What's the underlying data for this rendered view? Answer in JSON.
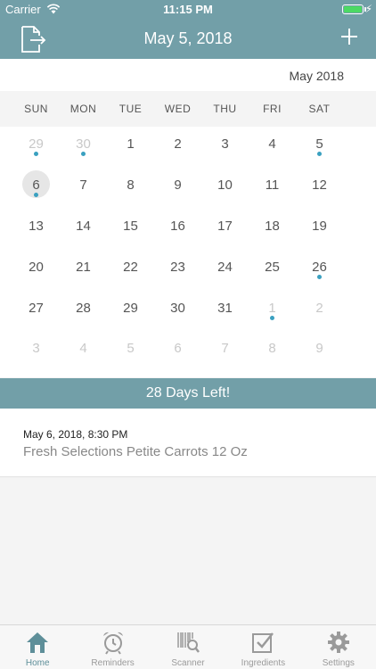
{
  "status_bar": {
    "carrier": "Carrier",
    "time": "11:15 PM",
    "bolt": "⚡"
  },
  "nav": {
    "title": "May 5, 2018"
  },
  "calendar": {
    "month_label": "May 2018",
    "weekdays": [
      "SUN",
      "MON",
      "TUE",
      "WED",
      "THU",
      "FRI",
      "SAT"
    ],
    "weeks": [
      [
        {
          "d": "29",
          "other": true,
          "dot": true
        },
        {
          "d": "30",
          "other": true,
          "dot": true
        },
        {
          "d": "1"
        },
        {
          "d": "2"
        },
        {
          "d": "3"
        },
        {
          "d": "4"
        },
        {
          "d": "5",
          "dot": true
        }
      ],
      [
        {
          "d": "6",
          "today": true,
          "dot": true
        },
        {
          "d": "7"
        },
        {
          "d": "8"
        },
        {
          "d": "9"
        },
        {
          "d": "10"
        },
        {
          "d": "11"
        },
        {
          "d": "12"
        }
      ],
      [
        {
          "d": "13"
        },
        {
          "d": "14"
        },
        {
          "d": "15"
        },
        {
          "d": "16"
        },
        {
          "d": "17"
        },
        {
          "d": "18"
        },
        {
          "d": "19"
        }
      ],
      [
        {
          "d": "20"
        },
        {
          "d": "21"
        },
        {
          "d": "22"
        },
        {
          "d": "23"
        },
        {
          "d": "24"
        },
        {
          "d": "25"
        },
        {
          "d": "26",
          "dot": true
        }
      ],
      [
        {
          "d": "27"
        },
        {
          "d": "28"
        },
        {
          "d": "29"
        },
        {
          "d": "30"
        },
        {
          "d": "31"
        },
        {
          "d": "1",
          "other": true,
          "dot": true
        },
        {
          "d": "2",
          "other": true
        }
      ],
      [
        {
          "d": "3",
          "other": true
        },
        {
          "d": "4",
          "other": true
        },
        {
          "d": "5",
          "other": true
        },
        {
          "d": "6",
          "other": true
        },
        {
          "d": "7",
          "other": true
        },
        {
          "d": "8",
          "other": true
        },
        {
          "d": "9",
          "other": true
        }
      ]
    ]
  },
  "banner": {
    "text": "28 Days Left!"
  },
  "reminder": {
    "datetime": "May 6, 2018, 8:30 PM",
    "name": "Fresh Selections Petite Carrots 12 Oz"
  },
  "tabs": [
    {
      "label": "Home",
      "icon": "home-icon",
      "active": true
    },
    {
      "label": "Reminders",
      "icon": "alarm-clock-icon"
    },
    {
      "label": "Scanner",
      "icon": "barcode-scanner-icon"
    },
    {
      "label": "Ingredients",
      "icon": "checkbox-icon"
    },
    {
      "label": "Settings",
      "icon": "gear-icon"
    }
  ],
  "colors": {
    "accent": "#729fa8",
    "dot": "#3aa0c0",
    "active_tab": "#5e8f99"
  }
}
